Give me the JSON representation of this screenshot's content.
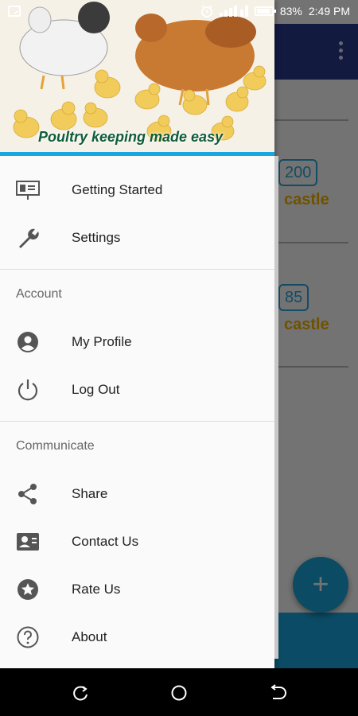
{
  "status_bar": {
    "battery": "83%",
    "time": "2:49 PM"
  },
  "header": {
    "tagline": "Poultry keeping made easy"
  },
  "drawer": {
    "items_top": [
      {
        "label": "Getting Started",
        "icon": "presentation-icon"
      },
      {
        "label": "Settings",
        "icon": "wrench-icon"
      }
    ],
    "account_title": "Account",
    "account_items": [
      {
        "label": "My Profile",
        "icon": "account-circle-icon"
      },
      {
        "label": "Log Out",
        "icon": "power-icon"
      }
    ],
    "communicate_title": "Communicate",
    "communicate_items": [
      {
        "label": "Share",
        "icon": "share-icon"
      },
      {
        "label": "Contact Us",
        "icon": "contact-card-icon"
      },
      {
        "label": "Rate Us",
        "icon": "star-circle-icon"
      },
      {
        "label": "About",
        "icon": "help-circle-icon"
      }
    ]
  },
  "background_list": [
    {
      "count": "200",
      "name": "castle"
    },
    {
      "count": "85",
      "name": "castle"
    }
  ],
  "fab": {
    "label": "+"
  },
  "colors": {
    "toolbar": "#2b3a8f",
    "accent": "#1aa6df",
    "highlight": "#f6b400"
  }
}
